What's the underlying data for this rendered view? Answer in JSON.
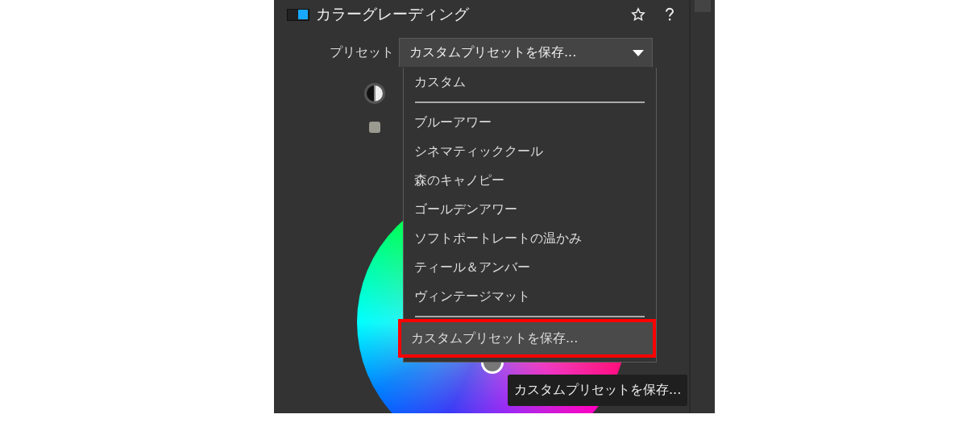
{
  "panel": {
    "title": "カラーグレーディング",
    "enabled": true
  },
  "preset": {
    "label": "プリセット",
    "value": "カスタムプリセットを保存..."
  },
  "menu": {
    "items": [
      {
        "kind": "item",
        "label": "カスタム",
        "selected": false
      },
      {
        "kind": "separator"
      },
      {
        "kind": "item",
        "label": "ブルーアワー",
        "selected": false
      },
      {
        "kind": "item",
        "label": "シネマティッククール",
        "selected": false
      },
      {
        "kind": "item",
        "label": "森のキャノピー",
        "selected": false
      },
      {
        "kind": "item",
        "label": "ゴールデンアワー",
        "selected": false
      },
      {
        "kind": "item",
        "label": "ソフトポートレートの温かみ",
        "selected": false
      },
      {
        "kind": "item",
        "label": "ティール＆アンバー",
        "selected": false
      },
      {
        "kind": "item",
        "label": "ヴィンテージマット",
        "selected": false
      },
      {
        "kind": "separator"
      },
      {
        "kind": "item",
        "label": "カスタムプリセットを保存...",
        "selected": true
      }
    ]
  },
  "tooltip": "カスタムプリセットを保存..."
}
